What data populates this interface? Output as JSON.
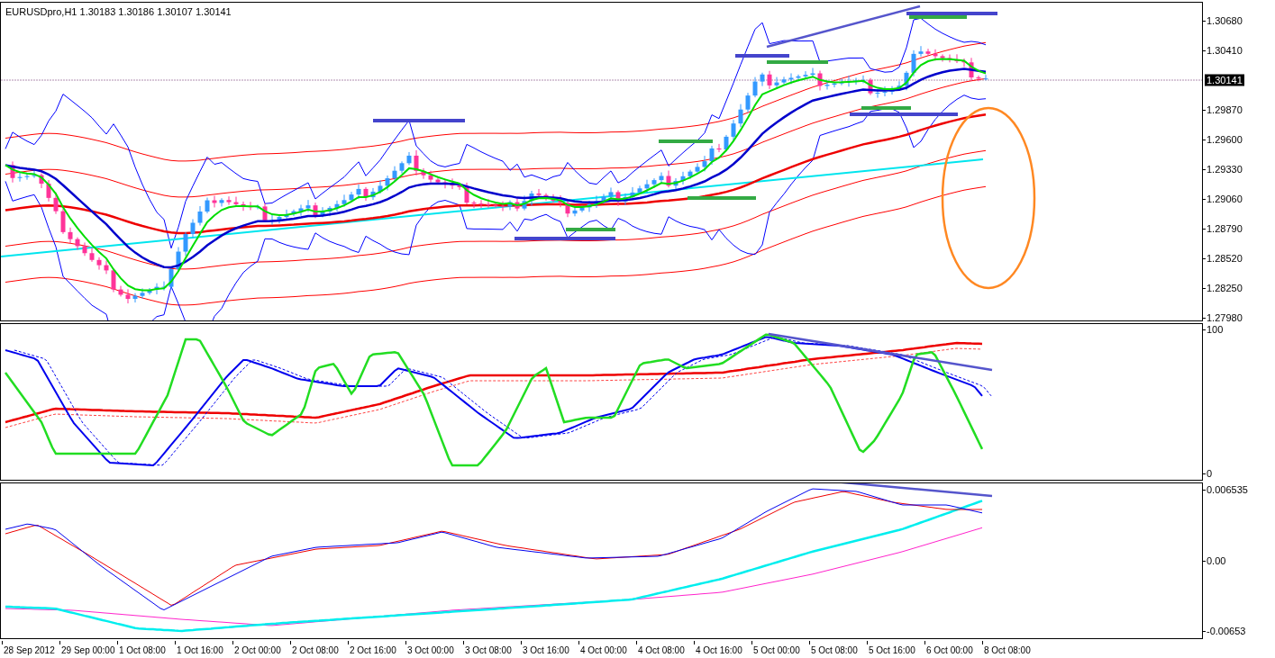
{
  "header": {
    "symbol": "EURUSDpro,H1",
    "prices": [
      "1.30183",
      "1.30186",
      "1.30107",
      "1.30141"
    ]
  },
  "price_axis": {
    "labels": [
      "1.30680",
      "1.30410",
      "1.29870",
      "1.29600",
      "1.29330",
      "1.29060",
      "1.28790",
      "1.28520",
      "1.28250",
      "1.27980"
    ],
    "current_price": "1.30141"
  },
  "oscillator_axis": {
    "labels": [
      "100",
      "0"
    ]
  },
  "histogram_axis": {
    "labels": [
      "0.006535",
      "0.00",
      "-0.00653"
    ]
  },
  "time_axis": {
    "labels": [
      "28 Sep 2012",
      "29 Sep 00:00",
      "1 Oct 08:00",
      "1 Oct 16:00",
      "2 Oct 00:00",
      "2 Oct 08:00",
      "2 Oct 16:00",
      "3 Oct 00:00",
      "3 Oct 08:00",
      "3 Oct 16:00",
      "4 Oct 00:00",
      "4 Oct 08:00",
      "4 Oct 16:00",
      "5 Oct 00:00",
      "5 Oct 08:00",
      "5 Oct 16:00",
      "6 Oct 00:00",
      "8 Oct 08:00"
    ]
  }
}
